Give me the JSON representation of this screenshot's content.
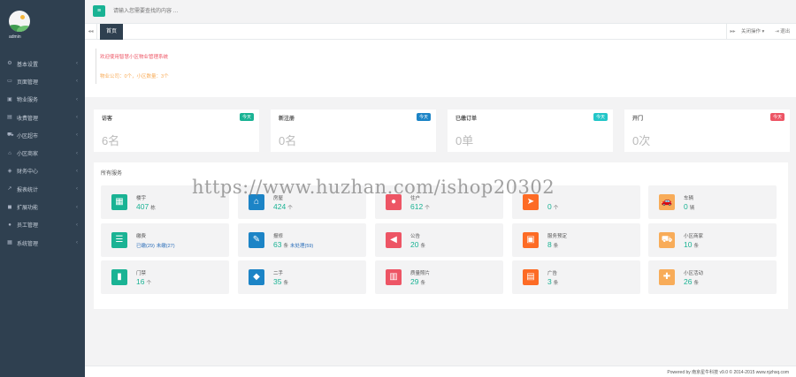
{
  "sidebar": {
    "user": "admin",
    "items": [
      {
        "label": "基本设置",
        "icon": "gear-icon"
      },
      {
        "label": "页面管理",
        "icon": "page-icon"
      },
      {
        "label": "物业服务",
        "icon": "service-icon"
      },
      {
        "label": "收费管理",
        "icon": "billing-icon"
      },
      {
        "label": "小区超市",
        "icon": "cart-icon"
      },
      {
        "label": "小区商家",
        "icon": "shop-icon"
      },
      {
        "label": "财务中心",
        "icon": "money-icon"
      },
      {
        "label": "报表统计",
        "icon": "chart-icon"
      },
      {
        "label": "扩展功能",
        "icon": "extension-icon"
      },
      {
        "label": "员工管理",
        "icon": "staff-icon"
      },
      {
        "label": "系统管理",
        "icon": "system-icon"
      }
    ]
  },
  "header": {
    "search_placeholder": "请输入您需要查找的内容 …"
  },
  "tabs": {
    "active": "首页",
    "close_ops": "关闭操作 ▾",
    "logout": "⇥ 退出"
  },
  "welcome": {
    "line1": "欢迎使用智慧小区物业管理系统",
    "line2": "物业公司：0个，小区数量：3个"
  },
  "stats": [
    {
      "title": "访客",
      "badge": "今天",
      "value": "6名",
      "color": "#1ab394"
    },
    {
      "title": "新注册",
      "badge": "今天",
      "value": "0名",
      "color": "#1c84c6"
    },
    {
      "title": "已缴订单",
      "badge": "今天",
      "value": "0单",
      "color": "#23c6c8"
    },
    {
      "title": "开门",
      "badge": "今天",
      "value": "0次",
      "color": "#ed5565"
    }
  ],
  "services": {
    "title": "所有服务",
    "tiles": [
      {
        "name": "楼宇",
        "num": "407",
        "unit": "栋",
        "color": "#1ab394",
        "icon": "building-icon",
        "glyph": "▦"
      },
      {
        "name": "房屋",
        "num": "424",
        "unit": "个",
        "color": "#1c84c6",
        "icon": "house-icon",
        "glyph": "⌂"
      },
      {
        "name": "住户",
        "num": "612",
        "unit": "个",
        "color": "#ed5565",
        "icon": "user-icon",
        "glyph": "●"
      },
      {
        "name": "",
        "num": "0",
        "unit": "个",
        "color": "#fd6b25",
        "icon": "send-icon",
        "glyph": "➤"
      },
      {
        "name": "车辆",
        "num": "0",
        "unit": "辆",
        "color": "#f8ac59",
        "icon": "car-icon",
        "glyph": "🚗"
      },
      {
        "name": "缴费",
        "sub": "已缴(29)",
        "sub2": "未缴(27)",
        "color": "#1ab394",
        "icon": "list-icon",
        "glyph": "☰"
      },
      {
        "name": "报修",
        "num": "63",
        "unit": "条",
        "extra": "未处理(59)",
        "color": "#1c84c6",
        "icon": "wrench-icon",
        "glyph": "✎"
      },
      {
        "name": "公告",
        "num": "20",
        "unit": "条",
        "color": "#ed5565",
        "icon": "megaphone-icon",
        "glyph": "◀"
      },
      {
        "name": "服务预定",
        "num": "8",
        "unit": "条",
        "color": "#fd6b25",
        "icon": "calendar-icon",
        "glyph": "▣"
      },
      {
        "name": "小区商家",
        "num": "10",
        "unit": "条",
        "color": "#f8ac59",
        "icon": "cart-icon",
        "glyph": "⛟"
      },
      {
        "name": "门禁",
        "num": "16",
        "unit": "个",
        "color": "#1ab394",
        "icon": "lock-icon",
        "glyph": "▮"
      },
      {
        "name": "二手",
        "num": "35",
        "unit": "条",
        "color": "#1c84c6",
        "icon": "cube-icon",
        "glyph": "◆"
      },
      {
        "name": "质量照片",
        "num": "29",
        "unit": "条",
        "color": "#ed5565",
        "icon": "bank-icon",
        "glyph": "▥"
      },
      {
        "name": "广告",
        "num": "3",
        "unit": "条",
        "color": "#fd6b25",
        "icon": "ad-icon",
        "glyph": "▤"
      },
      {
        "name": "小区活动",
        "num": "26",
        "unit": "条",
        "color": "#f8ac59",
        "icon": "gift-icon",
        "glyph": "✚"
      }
    ]
  },
  "watermark": "https://www.huzhan.com/ishop20302",
  "footer": "Powered by 南京星牛科技 v9.0 © 2014-2015 www.njzhsq.com"
}
